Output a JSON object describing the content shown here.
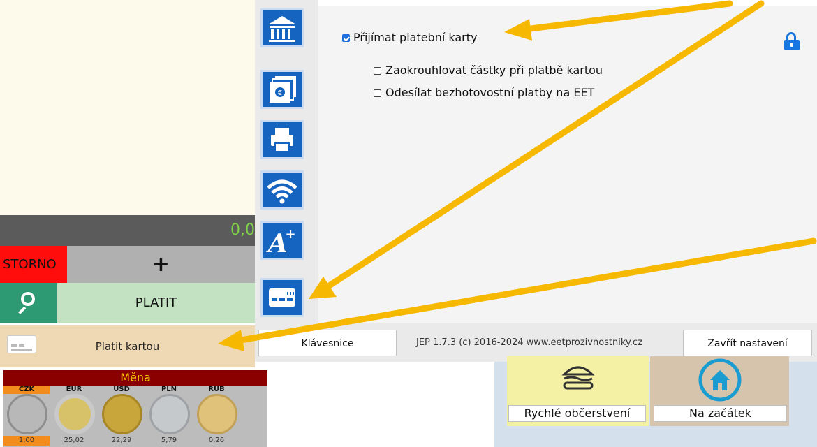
{
  "pos": {
    "total": "0,0",
    "storno": "STORNO",
    "plus": "+",
    "platit": "PLATIT",
    "platit_kartou": "Platit kartou",
    "mena": "Měna",
    "coins": [
      {
        "code": "CZK",
        "value": "1,00",
        "color": "#b8b8b8"
      },
      {
        "code": "EUR",
        "value": "25,02",
        "color": "#d7c26a"
      },
      {
        "code": "USD",
        "value": "22,29",
        "color": "#c9a63c"
      },
      {
        "code": "PLN",
        "value": "5,79",
        "color": "#c6c9cc"
      },
      {
        "code": "RUB",
        "value": "0,26",
        "color": "#e0c27a"
      }
    ]
  },
  "settings": {
    "sidebar_icons": [
      "bank-icon",
      "cash-icon",
      "printer-icon",
      "wifi-icon",
      "font-size-icon",
      "payment-card-icon"
    ],
    "accept_cards_label": "Přijímat platební karty",
    "accept_cards_checked": true,
    "round_label": "Zaokrouhlovat částky při platbě kartou",
    "round_checked": false,
    "eet_label": "Odesílat bezhotovostní platby na EET",
    "eet_checked": false
  },
  "bottom_bar": {
    "keyboard": "Klávesnice",
    "version": "JEP 1.7.3 (c) 2016-2024 www.eetprozivnostniky.cz",
    "close": "Zavřít nastavení"
  },
  "tiles": {
    "fast_food": "Rychlé občerstvení",
    "home": "Na začátek"
  },
  "colors": {
    "accent_blue": "#1564c0",
    "arrow": "#f6b800"
  }
}
